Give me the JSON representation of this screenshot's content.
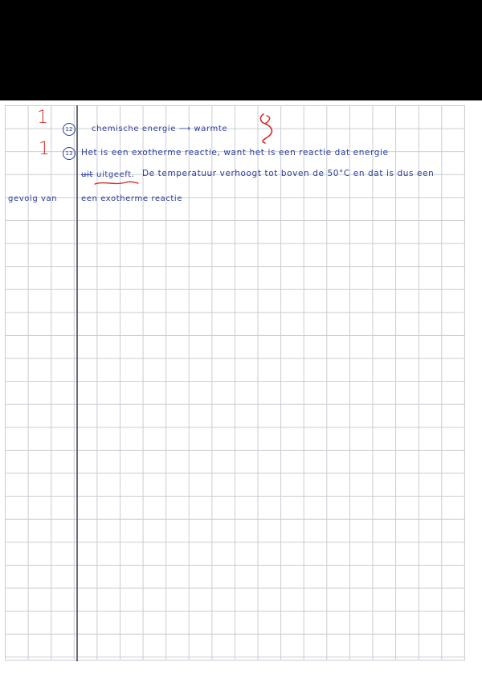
{
  "score_q12": "1",
  "score_q13": "1",
  "q12": {
    "number": "12",
    "text": "chemische energie ⟶ warmte"
  },
  "q13": {
    "number": "13",
    "line1": "Het is een exotherme reactie, want het is een reactie dat energie",
    "line2_crossed": "uit",
    "line2_a": "uitgeeft.",
    "line2_b": "De temperatuur verhoogt tot boven de 50°C en dat is dus een",
    "line3_margin": "gevolg van",
    "line3": "een exotherme reactie"
  },
  "colors": {
    "ink_blue": "#2b3e9c",
    "ink_red": "#d22b2b",
    "grid": "#c9ccd2"
  }
}
